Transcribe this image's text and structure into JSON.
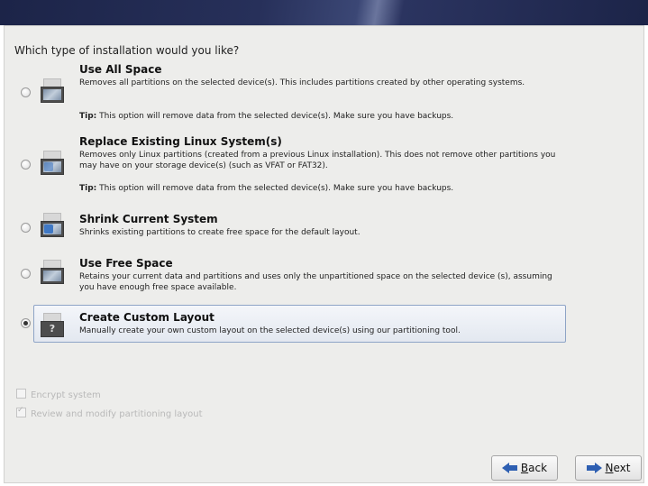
{
  "question": "Which type of installation would you like?",
  "options": [
    {
      "title": "Use All Space",
      "description": "Removes all partitions on the selected device(s).  This includes partitions created by other operating systems.",
      "tip_label": "Tip:",
      "tip_text": " This option will remove data from the selected device(s).  Make sure you have backups.",
      "icon": "drive-erase-icon",
      "selected": false
    },
    {
      "title": "Replace Existing Linux System(s)",
      "description": "Removes only Linux partitions (created from a previous Linux installation).  This does not remove other partitions you may have on your storage device(s) (such as VFAT or FAT32).",
      "tip_label": "Tip:",
      "tip_text": " This option will remove data from the selected device(s).  Make sure you have backups.",
      "icon": "drive-replace-icon",
      "selected": false
    },
    {
      "title": "Shrink Current System",
      "description": "Shrinks existing partitions to create free space for the default layout.",
      "icon": "drive-shrink-icon",
      "selected": false
    },
    {
      "title": "Use Free Space",
      "description": "Retains your current data and partitions and uses only the unpartitioned space on the selected device (s), assuming you have enough free space available.",
      "icon": "drive-freespace-icon",
      "selected": false
    },
    {
      "title": "Create Custom Layout",
      "description": "Manually create your own custom layout on the selected device(s) using our partitioning tool.",
      "icon": "drive-custom-icon",
      "selected": true
    }
  ],
  "encrypt": {
    "label": "Encrypt system",
    "checked": false
  },
  "review": {
    "label": "Review and modify partitioning layout",
    "checked": true
  },
  "buttons": {
    "back_letter": "B",
    "back_rest": "ack",
    "next_letter": "N",
    "next_rest": "ext"
  },
  "colors": {
    "accent": "#2e5fb2",
    "banner": "#1c2448",
    "selection_border": "#8ea4c6"
  }
}
